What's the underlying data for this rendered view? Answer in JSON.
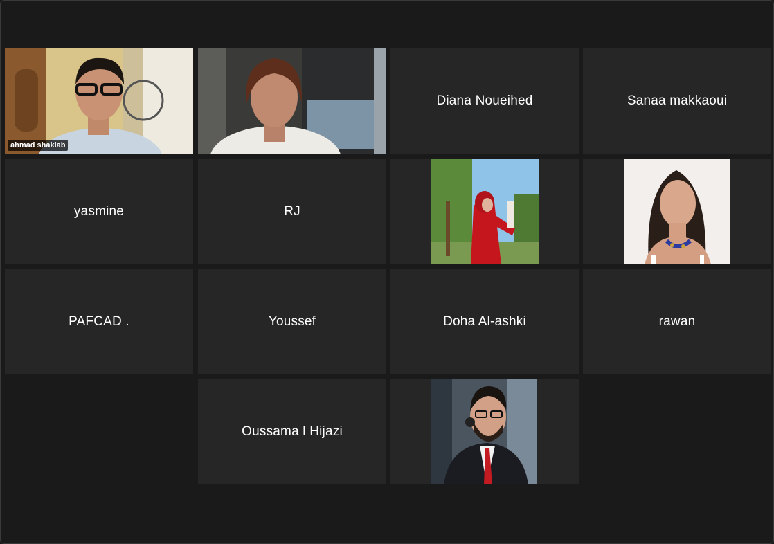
{
  "participants": [
    {
      "name": "ahmad shaklab",
      "video": true
    },
    {
      "name": "",
      "video": true
    },
    {
      "name": "Diana Noueihed",
      "video": false
    },
    {
      "name": "Sanaa makkaoui",
      "video": false
    },
    {
      "name": "yasmine",
      "video": false
    },
    {
      "name": "RJ",
      "video": false
    },
    {
      "name": "",
      "video": true
    },
    {
      "name": "",
      "video": true
    },
    {
      "name": "PAFCAD .",
      "video": false
    },
    {
      "name": "Youssef",
      "video": false
    },
    {
      "name": "Doha Al-ashki",
      "video": false
    },
    {
      "name": "rawan",
      "video": false
    },
    {
      "name": "Oussama l Hijazi",
      "video": false
    },
    {
      "name": "",
      "video": true
    }
  ],
  "active_speaker_color": "#b7e07a"
}
